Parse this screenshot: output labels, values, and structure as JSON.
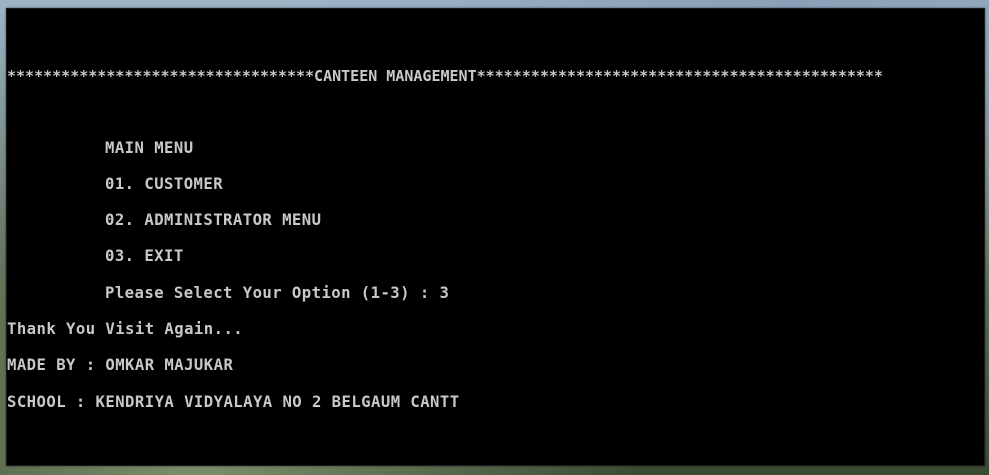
{
  "console": {
    "banner": "**********************************CANTEEN MANAGEMENT*********************************************",
    "menu_title": "MAIN MENU",
    "options": [
      "01. CUSTOMER",
      "02. ADMINISTRATOR MENU",
      "03. EXIT"
    ],
    "prompt": "Please Select Your Option (1-3) : 3",
    "thanks": "Thank You Visit Again...",
    "made_by": "MADE BY : OMKAR MAJUKAR",
    "school": "SCHOOL : KENDRIYA VIDYALAYA NO 2 BELGAUM CANTT"
  },
  "colors": {
    "console_background": "#000000",
    "console_text": "#c8c8c8"
  }
}
